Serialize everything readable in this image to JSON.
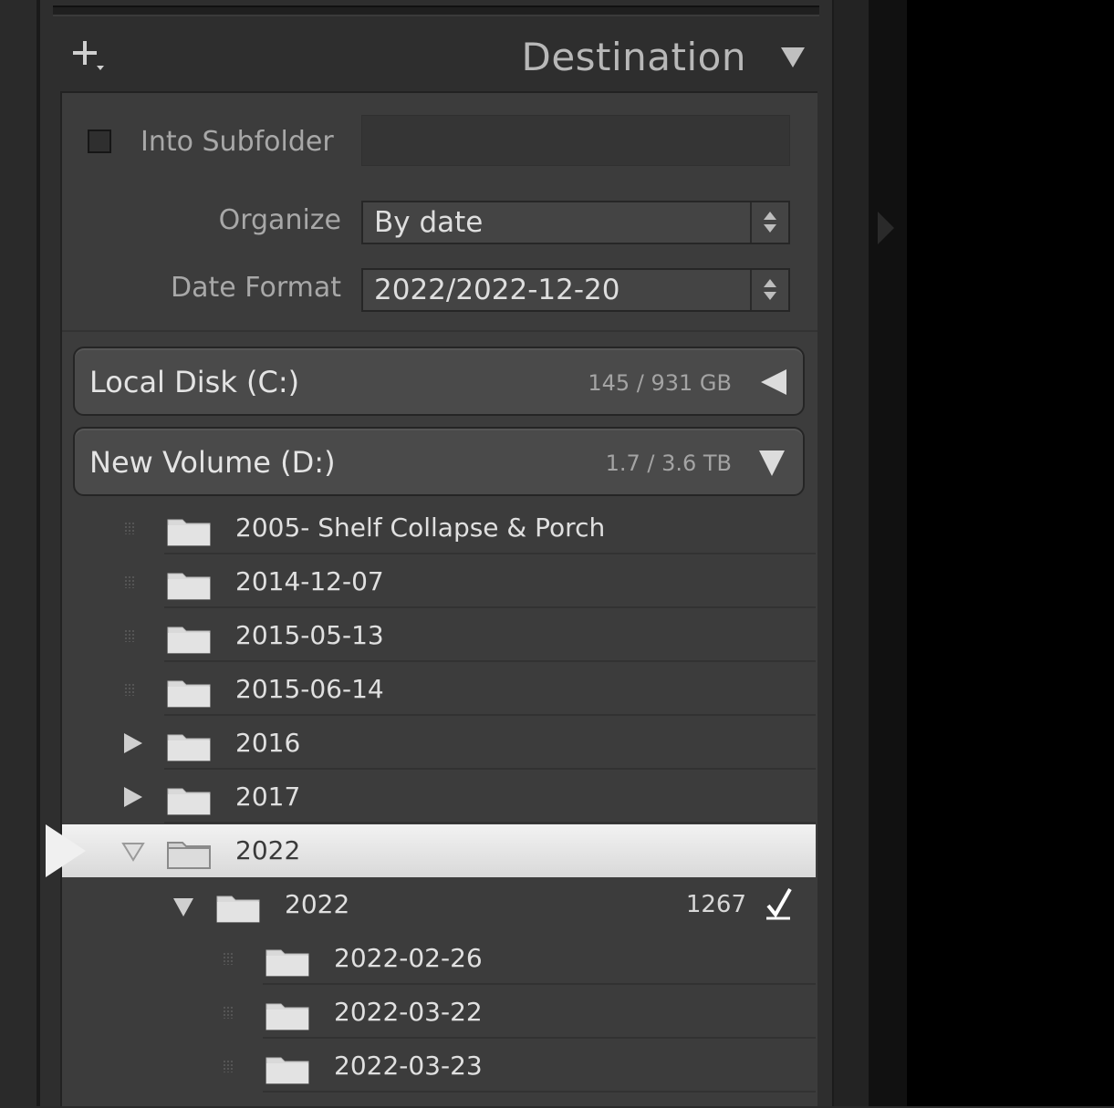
{
  "header": {
    "title": "Destination"
  },
  "options": {
    "subfolder_label": "Into Subfolder",
    "subfolder_value": "",
    "subfolder_checked": false,
    "organize_label": "Organize",
    "organize_value": "By date",
    "date_format_label": "Date Format",
    "date_format_value": "2022/2022-12-20"
  },
  "volumes": [
    {
      "name": "Local Disk (C:)",
      "size": "145 / 931 GB",
      "expanded": false
    },
    {
      "name": "New Volume (D:)",
      "size": "1.7 / 3.6 TB",
      "expanded": true
    }
  ],
  "folders": [
    {
      "label": "2005- Shelf Collapse & Porch",
      "state": "leaf"
    },
    {
      "label": "2014-12-07",
      "state": "leaf"
    },
    {
      "label": "2015-05-13",
      "state": "leaf"
    },
    {
      "label": "2015-06-14",
      "state": "leaf"
    },
    {
      "label": "2016",
      "state": "collapsed"
    },
    {
      "label": "2017",
      "state": "collapsed"
    },
    {
      "label": "2022",
      "state": "expanded",
      "selected": true
    },
    {
      "label": "2022",
      "state": "expanded",
      "count": "1267",
      "checked": true
    },
    {
      "label": "2022-02-26",
      "state": "leaf"
    },
    {
      "label": "2022-03-22",
      "state": "leaf"
    },
    {
      "label": "2022-03-23",
      "state": "leaf"
    }
  ],
  "icons": {
    "add": "plus-icon",
    "panel_toggle": "triangle-down-icon",
    "folder": "folder-icon",
    "check": "checkmark-icon"
  },
  "colors": {
    "panel_bg": "#3c3c3c",
    "selected_row": "#e8e8e8",
    "text": "#e0e0e0"
  }
}
